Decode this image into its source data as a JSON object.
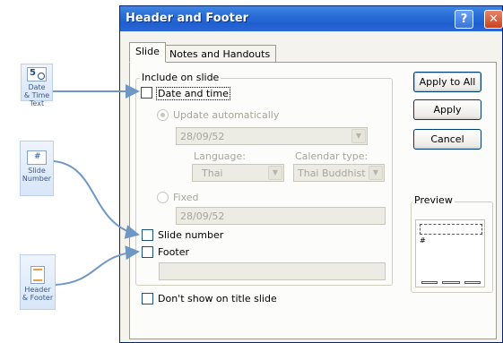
{
  "ribbon": {
    "date_time": {
      "line1": "Date",
      "line2": "& Time",
      "line3": "Text"
    },
    "slide_number": {
      "line1": "Slide",
      "line2": "Number"
    },
    "header_footer": {
      "line1": "Header",
      "line2": "& Footer"
    }
  },
  "dialog": {
    "title": "Header and Footer",
    "help_glyph": "?",
    "close_glyph": "✕"
  },
  "tabs": [
    {
      "label": "Slide",
      "active": true
    },
    {
      "label": "Notes and Handouts",
      "active": false
    }
  ],
  "include_group": {
    "label": "Include on slide",
    "date_time": {
      "label": "Date and time",
      "checked": false
    },
    "update_auto": {
      "label": "Update automatically",
      "selected": true,
      "enabled": false
    },
    "auto_date_value": "28/09/52",
    "language": {
      "label": "Language:",
      "value": "Thai"
    },
    "calendar": {
      "label": "Calendar type:",
      "value": "Thai Buddhist"
    },
    "fixed": {
      "label": "Fixed",
      "selected": false,
      "enabled": false
    },
    "fixed_value": "28/09/52",
    "slide_number": {
      "label": "Slide number",
      "checked": false
    },
    "footer": {
      "label": "Footer",
      "checked": false
    },
    "footer_value": ""
  },
  "dont_show_title": {
    "label": "Don't show on title slide",
    "checked": false
  },
  "buttons": {
    "apply_all": "Apply to All",
    "apply": "Apply",
    "cancel": "Cancel"
  },
  "preview": {
    "label": "Preview",
    "page_marker": "#"
  },
  "colors": {
    "titlebar": "#2b6fd7",
    "connector": "#6f97c6",
    "checkbox_border": "#1c5180"
  }
}
